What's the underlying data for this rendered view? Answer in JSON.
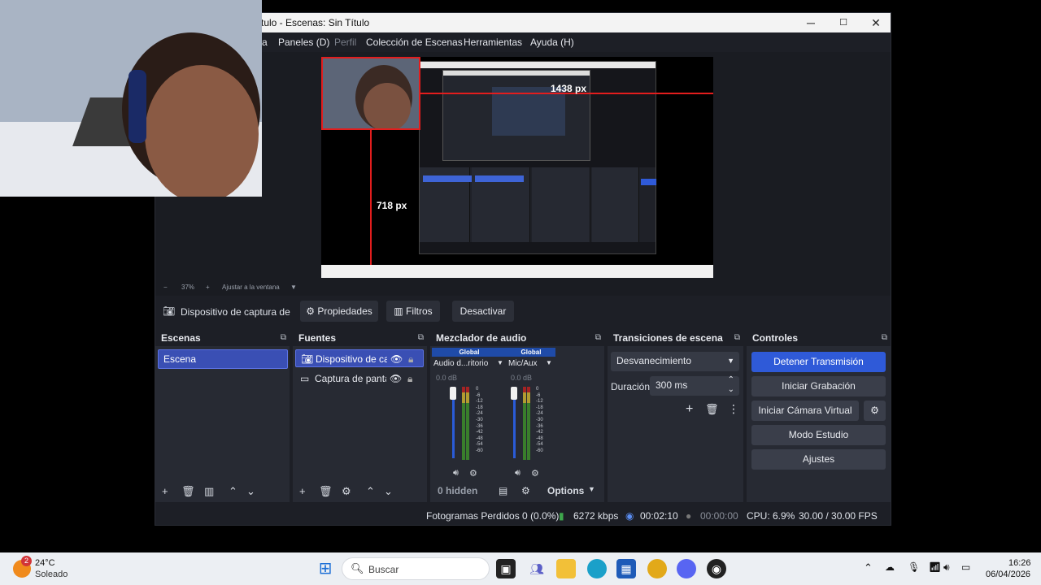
{
  "window": {
    "title": "tulo - Escenas: Sin Título",
    "minimize": "─",
    "maximize": "☐",
    "close": "✕"
  },
  "menu": [
    {
      "label": "a",
      "dim": false
    },
    {
      "label": "Paneles (D)",
      "dim": false
    },
    {
      "label": "Perfil",
      "dim": true
    },
    {
      "label": "Colección de Escenas",
      "dim": false
    },
    {
      "label": "Herramientas",
      "dim": false
    },
    {
      "label": "Ayuda (H)",
      "dim": false
    }
  ],
  "preview": {
    "width_label": "1438 px",
    "height_label": "718 px",
    "zoom_minus": "−",
    "zoom": "37%",
    "zoom_plus": "+",
    "fit": "Ajustar a la ventana"
  },
  "source_toolbar": {
    "source_name": "Dispositivo de captura de v",
    "properties": "Propiedades",
    "filters": "Filtros",
    "deactivate": "Desactivar"
  },
  "scenes": {
    "title": "Escenas",
    "items": [
      "Escena"
    ]
  },
  "sources": {
    "title": "Fuentes",
    "items": [
      {
        "label": "Dispositivo de cap",
        "icon": "camera-icon",
        "selected": true
      },
      {
        "label": "Captura de panta",
        "icon": "monitor-icon",
        "selected": false
      }
    ]
  },
  "mixer": {
    "title": "Mezclador de audio",
    "channels": [
      {
        "global": "Global",
        "name": "Audio d...ritorio",
        "db": "0.0 dB"
      },
      {
        "global": "Global",
        "name": "Mic/Aux",
        "db": "0.0 dB"
      }
    ],
    "scale": [
      "0",
      "-6",
      "-12",
      "-18",
      "-24",
      "-30",
      "-36",
      "-42",
      "-48",
      "-54",
      "-60"
    ],
    "hidden": "0 hidden",
    "options": "Options"
  },
  "transitions": {
    "title": "Transiciones de escena",
    "selected": "Desvanecimiento",
    "duration_label": "Duración",
    "duration_value": "300 ms"
  },
  "controls": {
    "title": "Controles",
    "stop_stream": "Detener Transmisión",
    "start_record": "Iniciar Grabación",
    "virtual_cam": "Iniciar Cámara Virtual",
    "studio_mode": "Modo Estudio",
    "settings": "Ajustes"
  },
  "status": {
    "dropped": "Fotogramas Perdidos 0 (0.0%)",
    "kbps": "6272 kbps",
    "stream_time": "00:02:10",
    "record_time": "00:00:00",
    "cpu": "CPU: 6.9%",
    "fps": "30.00 / 30.00 FPS"
  },
  "taskbar": {
    "weather_temp": "24°C",
    "weather_desc": "Soleado",
    "weather_badge": "2",
    "search_placeholder": "Buscar",
    "time": "16:26",
    "date": "06/04/2026"
  },
  "colors": {
    "accent": "#2f5ad8",
    "selection": "#e31d1d",
    "panel": "#272a33"
  }
}
